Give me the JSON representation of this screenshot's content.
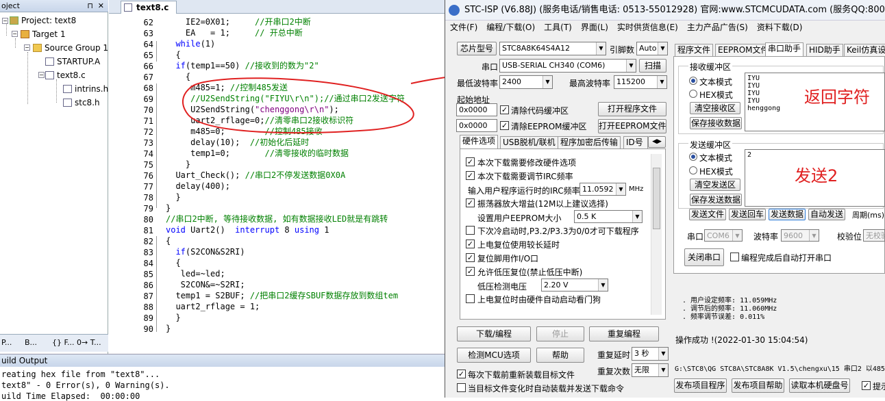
{
  "project_panel": {
    "title": "oject",
    "tree": [
      {
        "label": "Project: text8"
      },
      {
        "label": "Target 1"
      },
      {
        "label": "Source Group 1"
      },
      {
        "label": "STARTUP.A"
      },
      {
        "label": "text8.c"
      },
      {
        "label": "intrins.h"
      },
      {
        "label": "stc8.h"
      }
    ],
    "tabs": [
      "P...",
      "B...",
      "{} F...",
      "0→ T..."
    ]
  },
  "editor": {
    "tab_label": "text8.c",
    "line_numbers": [
      "62",
      "63",
      "64",
      "65",
      "66",
      "67",
      "68",
      "69",
      "70",
      "71",
      "72",
      "73",
      "74",
      "75",
      "76",
      "77",
      "78",
      "79",
      "80",
      "81",
      "82",
      "83",
      "84",
      "85",
      "86",
      "87",
      "88",
      "89",
      "90"
    ]
  },
  "build_output": {
    "title": "uild Output",
    "lines": [
      "reating hex file from \"text8\"...",
      "text8\" - 0 Error(s), 0 Warning(s).",
      "uild Time Elapsed:  00:00:00"
    ]
  },
  "stc": {
    "title": "STC-ISP (V6.88J) (服务电话/销售电话: 0513-55012928) 官网:www.STCMCUDATA.com (服务QQ:800003751) -",
    "menu": [
      "文件(F)",
      "编程/下载(O)",
      "工具(T)",
      "界面(L)",
      "实时供货信息(E)",
      "主力产品广告(S)",
      "资料下载(D)"
    ],
    "chip_label": "芯片型号",
    "chip_value": "STC8A8K64S4A12",
    "pins_label": "引脚数",
    "pins_value": "Auto",
    "port_label": "串口",
    "port_value": "USB-SERIAL CH340 (COM6)",
    "scan_button": "扫描",
    "min_baud_label": "最低波特率",
    "min_baud_value": "2400",
    "max_baud_label": "最高波特率",
    "max_baud_value": "115200",
    "start_addr_label": "起始地址",
    "code_addr": "0x0000",
    "clear_code_label": "清除代码缓冲区",
    "open_program_button": "打开程序文件",
    "eeprom_addr": "0x0000",
    "clear_eeprom_label": "清除EEPROM缓冲区",
    "open_eeprom_button": "打开EEPROM文件",
    "hw_tabs": [
      "硬件选项",
      "USB脱机/联机",
      "程序加密后传输",
      "ID号"
    ],
    "options": [
      {
        "label": "本次下载需要修改硬件选项",
        "checked": true
      },
      {
        "label": "本次下载需要调节IRC频率",
        "checked": true
      },
      {
        "label": "振荡器放大增益(12M以上建议选择)",
        "checked": true
      },
      {
        "label": "下次冷启动时,P3.2/P3.3为0/0才可下载程序",
        "checked": false
      },
      {
        "label": "上电复位使用较长延时",
        "checked": true
      },
      {
        "label": "复位脚用作I/O口",
        "checked": true
      },
      {
        "label": "允许低压复位(禁止低压中断)",
        "checked": true
      },
      {
        "label": "上电复位时由硬件自动启动看门狗",
        "checked": false
      }
    ],
    "irc_label": "输入用户程序运行时的IRC频率",
    "irc_value": "11.0592",
    "irc_unit": "MHz",
    "eeprom_size_label": "设置用户EEPROM大小",
    "eeprom_size_value": "0.5 K",
    "lvd_label": "低压检测电压",
    "lvd_value": "2.20 V",
    "download_button": "下载/编程",
    "stop_button": "停止",
    "reprogram_button": "重复编程",
    "detect_button": "检测MCU选项",
    "help_button": "帮助",
    "repeat_delay_label": "重复延时",
    "repeat_delay_value": "3 秒",
    "repeat_count_label": "重复次数",
    "repeat_count_value": "无限",
    "reload_label": "每次下载前重新装载目标文件",
    "auto_send_label": "当目标文件变化时自动装载并发送下载命令",
    "right_tabs": [
      "程序文件",
      "EEPROM文件",
      "串口助手",
      "HID助手",
      "Keil仿真设"
    ],
    "recv_group": "接收缓冲区",
    "text_mode": "文本模式",
    "hex_mode": "HEX模式",
    "clear_recv_button": "清空接收区",
    "save_recv_button": "保存接收数据",
    "recv_lines": [
      "IYU",
      "IYU",
      "IYU",
      "IYU",
      "henggong"
    ],
    "send_group": "发送缓冲区",
    "send_text": "2",
    "clear_send_button": "清空发送区",
    "save_send_button": "保存发送数据",
    "send_file_button": "发送文件",
    "send_enter_button": "发送回车",
    "send_data_button": "发送数据",
    "auto_send_button": "自动发送",
    "period_label": "周期(ms)",
    "com_label": "串口",
    "com_value": "COM6",
    "baud_label": "波特率",
    "baud_value": "9600",
    "parity_label": "校验位",
    "parity_value": "无校验",
    "close_port_button": "关闭串口",
    "auto_open_label": "编程完成后自动打开串口",
    "status_lines": [
      ". 用户设定频率: 11.059MHz",
      ". 调节后的频率: 11.060MHz",
      ". 频率调节误差: 0.011%"
    ],
    "success_text": "操作成功 !(2022-01-30 15:04:54)",
    "path_text": "G:\\STC8\\QG STC8A\\STC8A8K V1.5\\chengxu\\15 串口2 以485",
    "publish_button": "发布项目程序",
    "publish_help_button": "发布项目帮助",
    "read_disk_button": "读取本机硬盘号",
    "hint_label": "提示"
  },
  "annotations": {
    "returned_chars": "返回字符",
    "send_two": "发送2",
    "color": "#e02020"
  }
}
